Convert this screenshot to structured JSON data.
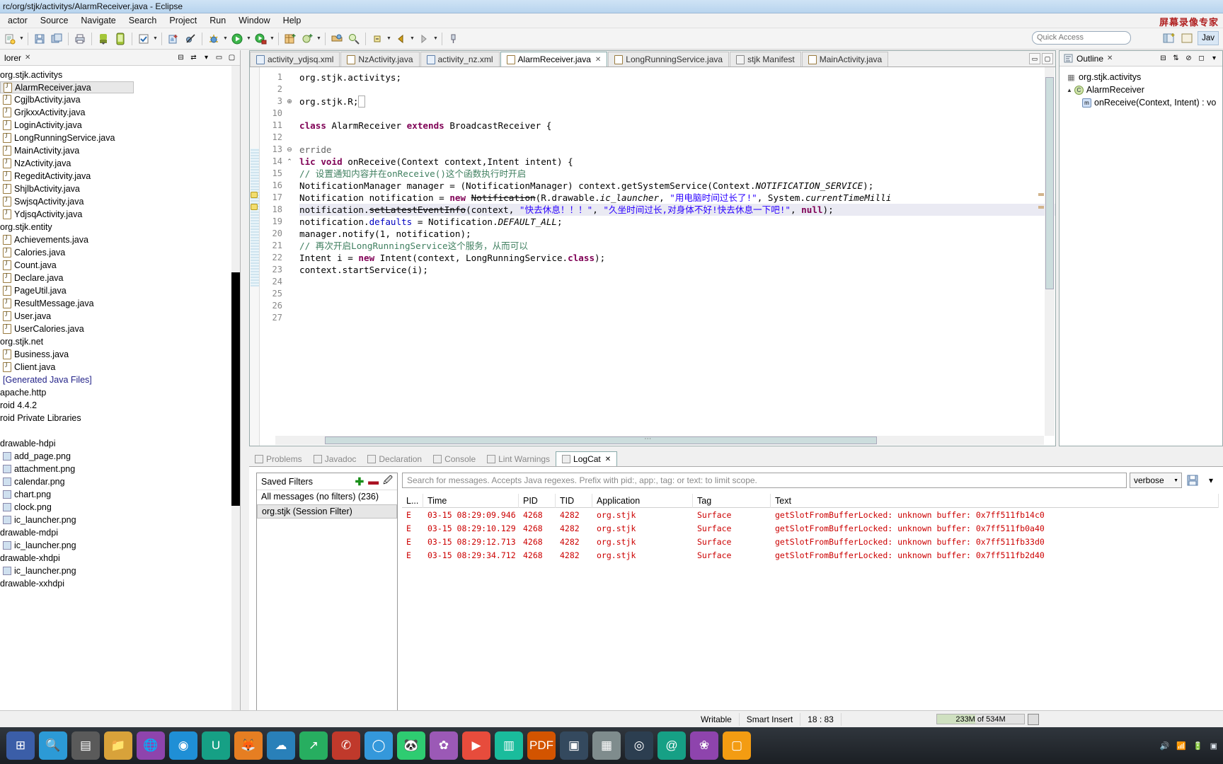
{
  "window": {
    "title": "rc/org/stjk/activitys/AlarmReceiver.java - Eclipse",
    "watermark": "屏幕录像专家"
  },
  "menubar": {
    "items": [
      "actor",
      "Source",
      "Navigate",
      "Search",
      "Project",
      "Run",
      "Window",
      "Help"
    ]
  },
  "toolbar": {
    "quick_access_placeholder": "Quick Access",
    "perspective_label": "Jav",
    "icons": [
      "new-icon",
      "new-dropdown",
      "save-icon",
      "save-all-icon",
      "print-icon",
      "sep",
      "android-sdk-manager-icon",
      "android-avd-manager-icon",
      "check-icon",
      "check-dropdown",
      "sep",
      "new-android-icon",
      "skip-breakpoints-icon",
      "debug-icon",
      "debug-dropdown",
      "run-icon",
      "run-dropdown",
      "external-tools-icon",
      "external-tools-dropdown",
      "sep",
      "new-java-package-icon",
      "new-java-class-icon",
      "new-class-dropdown",
      "sep",
      "open-type-icon",
      "search-icon",
      "sep",
      "next-annotation-icon",
      "prev-annotation-icon",
      "back-icon",
      "back-dropdown",
      "forward-icon",
      "forward-dropdown",
      "sep",
      "pin-icon"
    ]
  },
  "explorer": {
    "tab_label": "lorer",
    "tab_close": "✕",
    "tree": [
      {
        "type": "pkg",
        "label": "org.stjk.activitys"
      },
      {
        "type": "java",
        "label": "AlarmReceiver.java",
        "selected": true
      },
      {
        "type": "java",
        "label": "CgjlbActivity.java"
      },
      {
        "type": "java",
        "label": "GrjkxxActivity.java"
      },
      {
        "type": "java",
        "label": "LoginActivity.java"
      },
      {
        "type": "java",
        "label": "LongRunningService.java"
      },
      {
        "type": "java",
        "label": "MainActivity.java"
      },
      {
        "type": "java",
        "label": "NzActivity.java"
      },
      {
        "type": "java",
        "label": "RegeditActivity.java"
      },
      {
        "type": "java",
        "label": "ShjlbActivity.java"
      },
      {
        "type": "java",
        "label": "SwjsqActivity.java"
      },
      {
        "type": "java",
        "label": "YdjsqActivity.java"
      },
      {
        "type": "pkg",
        "label": "org.stjk.entity"
      },
      {
        "type": "java",
        "label": "Achievements.java"
      },
      {
        "type": "java",
        "label": "Calories.java"
      },
      {
        "type": "java",
        "label": "Count.java"
      },
      {
        "type": "java",
        "label": "Declare.java"
      },
      {
        "type": "java",
        "label": "PageUtil.java"
      },
      {
        "type": "java",
        "label": "ResultMessage.java"
      },
      {
        "type": "java",
        "label": "User.java"
      },
      {
        "type": "java",
        "label": "UserCalories.java"
      },
      {
        "type": "pkg",
        "label": "org.stjk.net"
      },
      {
        "type": "java",
        "label": "Business.java"
      },
      {
        "type": "java",
        "label": "Client.java"
      },
      {
        "type": "gen",
        "label": "[Generated Java Files]"
      },
      {
        "type": "pkg",
        "label": "apache.http"
      },
      {
        "type": "pkg",
        "label": "roid 4.4.2"
      },
      {
        "type": "pkg",
        "label": "roid Private Libraries"
      },
      {
        "type": "blank",
        "label": ""
      },
      {
        "type": "pkg",
        "label": "drawable-hdpi"
      },
      {
        "type": "png",
        "label": "add_page.png"
      },
      {
        "type": "png",
        "label": "attachment.png"
      },
      {
        "type": "png",
        "label": "calendar.png"
      },
      {
        "type": "png",
        "label": "chart.png"
      },
      {
        "type": "png",
        "label": "clock.png"
      },
      {
        "type": "png",
        "label": "ic_launcher.png"
      },
      {
        "type": "pkg",
        "label": "drawable-mdpi"
      },
      {
        "type": "png",
        "label": "ic_launcher.png"
      },
      {
        "type": "pkg",
        "label": "drawable-xhdpi"
      },
      {
        "type": "png",
        "label": "ic_launcher.png"
      },
      {
        "type": "pkg",
        "label": "drawable-xxhdpi"
      }
    ]
  },
  "editor": {
    "tabs": [
      {
        "label": "activity_ydjsq.xml",
        "icon": "xml",
        "active": false
      },
      {
        "label": "NzActivity.java",
        "icon": "java",
        "active": false
      },
      {
        "label": "activity_nz.xml",
        "icon": "xml",
        "active": false
      },
      {
        "label": "AlarmReceiver.java",
        "icon": "java",
        "active": true,
        "close": "✕"
      },
      {
        "label": "LongRunningService.java",
        "icon": "java",
        "active": false
      },
      {
        "label": "stjk Manifest",
        "icon": "mf",
        "active": false
      },
      {
        "label": "MainActivity.java",
        "icon": "java",
        "active": false
      }
    ],
    "tab_buttons": [
      "minimize-editor-icon",
      "maximize-editor-icon"
    ],
    "lines": [
      {
        "num": "1",
        "fold": "",
        "html": "  org.stjk.activitys;"
      },
      {
        "num": "2",
        "fold": "",
        "html": ""
      },
      {
        "num": "3",
        "fold": "⊕",
        "html": "org.stjk.R;<span style='border:1px solid #aaa;color:#888'>&nbsp;</span>"
      },
      {
        "num": "10",
        "fold": "",
        "html": ""
      },
      {
        "num": "11",
        "fold": "",
        "html": "<span class='kw'>class</span> AlarmReceiver <span class='kw'>extends</span> BroadcastReceiver {"
      },
      {
        "num": "12",
        "fold": "",
        "html": ""
      },
      {
        "num": "13",
        "fold": "⊖",
        "html": "<span style='color:#646464'>erride</span>"
      },
      {
        "num": "14",
        "fold": "⌃",
        "html": "<span class='kw'>lic void</span> onReceive(Context context,Intent intent) {"
      },
      {
        "num": "15",
        "fold": "",
        "html": "  <span class='cmt'>// 设置通知内容并在onReceive()这个函数执行时开启</span>"
      },
      {
        "num": "16",
        "fold": "",
        "html": "  NotificationManager manager = (NotificationManager) context.getSystemService(Context.<span class='stat'>NOTIFICATION_SERVICE</span>);"
      },
      {
        "num": "17",
        "fold": "",
        "html": "  Notification notification = <span class='kw'>new</span> <span class='dep'>Notification</span>(R.drawable.<span class='stat'>ic_launcher</span>, <span class='str'>\"用电脑时间过长了!\"</span>, System.<span class='stat'>currentTimeMilli</span>"
      },
      {
        "num": "18",
        "fold": "",
        "html": "  notification.<span class='dep'>setLatestEventInfo</span>(context, <span class='str'>\"快去休息！！！\"</span>, <span class='str'>\"久坐时间过长,对身体不好!快去休息一下吧!\"</span>, <span class='kw'>null</span>);",
        "highlight": true
      },
      {
        "num": "19",
        "fold": "",
        "html": "  notification.<span class='fld'>defaults</span> = Notification.<span class='stat'>DEFAULT_ALL</span>;"
      },
      {
        "num": "20",
        "fold": "",
        "html": "  manager.notify(1, notification);"
      },
      {
        "num": "21",
        "fold": "",
        "html": "  <span class='cmt'>// 再次开启LongRunningService这个服务，从而可以</span>"
      },
      {
        "num": "22",
        "fold": "",
        "html": "  Intent i = <span class='kw'>new</span> Intent(context, LongRunningService.<span class='kw'>class</span>);"
      },
      {
        "num": "23",
        "fold": "",
        "html": "  context.startService(i);"
      },
      {
        "num": "24",
        "fold": "",
        "html": ""
      },
      {
        "num": "25",
        "fold": "",
        "html": ""
      },
      {
        "num": "26",
        "fold": "",
        "html": ""
      },
      {
        "num": "27",
        "fold": "",
        "html": ""
      }
    ]
  },
  "outline": {
    "tab_label": "Outline",
    "tab_close": "✕",
    "items": [
      {
        "icon": "pkg",
        "label": "org.stjk.activitys",
        "indent": 0
      },
      {
        "icon": "class",
        "label": "AlarmReceiver",
        "indent": 0,
        "arrow": "▲"
      },
      {
        "icon": "method",
        "label": "onReceive(Context, Intent) : vo",
        "indent": 1
      }
    ],
    "toolbar_icons": [
      "collapse-all-icon",
      "sort-icon",
      "hide-fields-icon",
      "hide-static-icon",
      "hide-nonpublic-icon",
      "view-menu-icon"
    ]
  },
  "bottom_panel": {
    "tabs": [
      {
        "label": "Problems",
        "active": false
      },
      {
        "label": "Javadoc",
        "active": false
      },
      {
        "label": "Declaration",
        "active": false
      },
      {
        "label": "Console",
        "active": false
      },
      {
        "label": "Lint Warnings",
        "active": false
      },
      {
        "label": "LogCat",
        "active": true,
        "close": "✕"
      }
    ]
  },
  "logcat": {
    "filters_title": "Saved Filters",
    "filter_actions": [
      "add-filter-icon",
      "remove-filter-icon",
      "edit-filter-icon"
    ],
    "filters": [
      {
        "label": "All messages (no filters) (236)",
        "selected": false
      },
      {
        "label": "org.stjk (Session Filter)",
        "selected": true
      }
    ],
    "search_placeholder": "Search for messages. Accepts Java regexes. Prefix with pid:, app:, tag: or text: to limit scope.",
    "level_selected": "verbose",
    "save_icon": "save-log-icon",
    "columns": [
      "L...",
      "Time",
      "PID",
      "TID",
      "Application",
      "Tag",
      "Text"
    ],
    "rows": [
      {
        "level": "E",
        "time": "03-15 08:29:09.946",
        "pid": "4268",
        "tid": "4282",
        "app": "org.stjk",
        "tag": "Surface",
        "text": "getSlotFromBufferLocked: unknown buffer: 0x7ff511fb14c0"
      },
      {
        "level": "E",
        "time": "03-15 08:29:10.129",
        "pid": "4268",
        "tid": "4282",
        "app": "org.stjk",
        "tag": "Surface",
        "text": "getSlotFromBufferLocked: unknown buffer: 0x7ff511fb0a40"
      },
      {
        "level": "E",
        "time": "03-15 08:29:12.713",
        "pid": "4268",
        "tid": "4282",
        "app": "org.stjk",
        "tag": "Surface",
        "text": "getSlotFromBufferLocked: unknown buffer: 0x7ff511fb33d0"
      },
      {
        "level": "E",
        "time": "03-15 08:29:34.712",
        "pid": "4268",
        "tid": "4282",
        "app": "org.stjk",
        "tag": "Surface",
        "text": "getSlotFromBufferLocked: unknown buffer: 0x7ff511fb2d40"
      }
    ]
  },
  "statusbar": {
    "writable": "Writable",
    "insert_mode": "Smart Insert",
    "position": "18 : 83",
    "memory": "233M of 534M",
    "trash_icon": "trash-icon"
  },
  "taskbar": {
    "icons": [
      "windows-start-icon",
      "search-icon",
      "task-view-icon",
      "file-explorer-icon",
      "eclipse-icon",
      "gradient-ball-icon",
      "ue-editor-icon",
      "firefox-icon",
      "cloud-icon",
      "blue-arrow-icon",
      "phone-app-icon",
      "chrome-icon",
      "panda-icon",
      "teal-flower-icon",
      "play-store-icon",
      "media-icon",
      "pdf-icon",
      "green-app-icon",
      "store-icon",
      "browser-icon",
      "spiral-icon",
      "terminal-icon",
      "folder-icon"
    ],
    "tray_icons": [
      "volume-icon",
      "network-icon",
      "battery-icon",
      "notification-icon"
    ]
  },
  "colors": {
    "accent": "#2a00ff",
    "keyword": "#7f0055",
    "comment": "#3f7f5f",
    "error": "#cc0000",
    "title_bar": "#cfe3f5"
  }
}
